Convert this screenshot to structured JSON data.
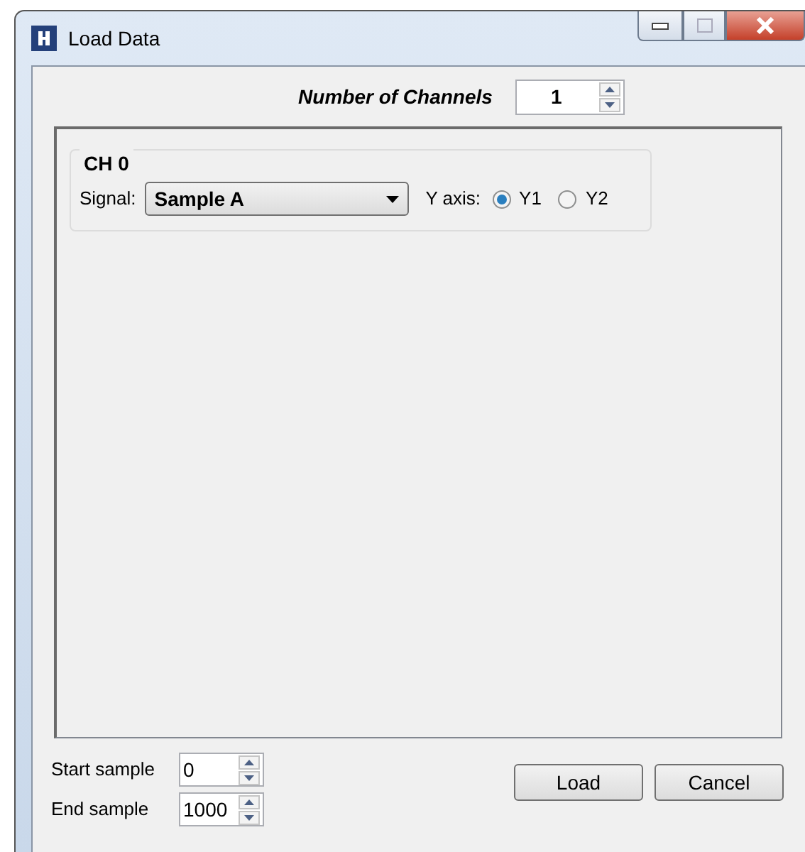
{
  "window": {
    "title": "Load Data"
  },
  "channel_count": {
    "label": "Number of Channels",
    "value": "1"
  },
  "channels": [
    {
      "title": "CH 0",
      "signal_label": "Signal:",
      "signal": "Sample A",
      "axis_label": "Y axis:",
      "axes": [
        {
          "label": "Y1",
          "selected": true
        },
        {
          "label": "Y2",
          "selected": false
        }
      ]
    }
  ],
  "range": [
    {
      "label": "Start sample",
      "value": "0"
    },
    {
      "label": "End sample",
      "value": "1000"
    }
  ],
  "buttons": [
    "Load",
    "Cancel"
  ]
}
